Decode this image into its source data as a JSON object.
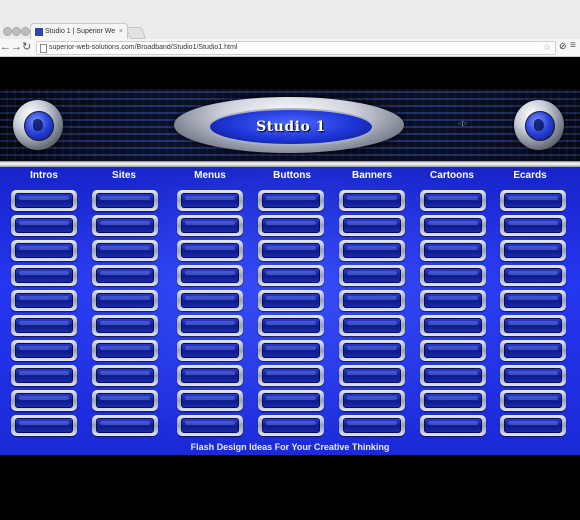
{
  "browser": {
    "tab_title": "Studio 1 | Superior Web So",
    "tab_close": "×",
    "url": "superior-web-solutions.com/Broadband/Studio1/Studio1.html",
    "back_icon": "←",
    "forward_icon": "→",
    "reload_icon": "↻",
    "star_icon": "☆",
    "ext_icon": "⊘",
    "menu_icon": "≡"
  },
  "header": {
    "logo_text": "Studio 1",
    "tiny_link": "◁▷"
  },
  "categories": [
    {
      "label": "Intros"
    },
    {
      "label": "Sites"
    },
    {
      "label": "Menus"
    },
    {
      "label": "Buttons"
    },
    {
      "label": "Banners"
    },
    {
      "label": "Cartoons"
    },
    {
      "label": "Ecards"
    }
  ],
  "slots_per_column": 10,
  "footer": {
    "tagline": "Flash Design Ideas For Your Creative Thinking"
  },
  "colors": {
    "panel_blue": "#1f30e0",
    "page_black": "#000000",
    "chrome_gray": "#ececec"
  }
}
